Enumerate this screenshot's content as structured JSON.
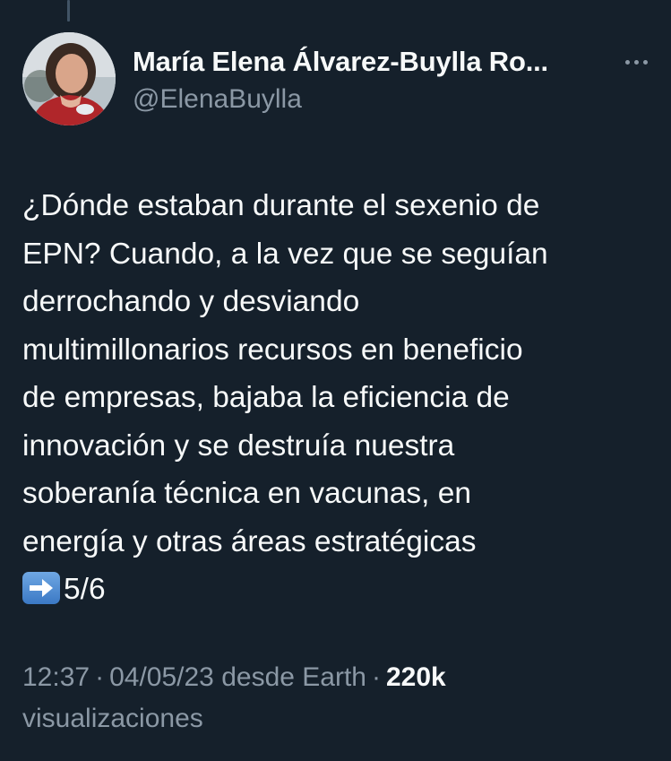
{
  "tweet": {
    "author": {
      "display_name": "María Elena Álvarez-Buylla Ro...",
      "handle": "@ElenaBuylla",
      "avatar_icon": "profile-photo"
    },
    "more_icon": "ellipsis-icon",
    "text_lines": [
      "¿Dónde estaban durante el sexenio de",
      "EPN? Cuando, a la vez que se seguían",
      "derrochando y desviando",
      "multimillonarios recursos en beneficio",
      "de empresas, bajaba la eficiencia de",
      "innovación y se destruía nuestra",
      "soberanía técnica en vacunas, en",
      "energía y otras áreas estratégicas"
    ],
    "thread_emoji": "right-arrow-emoji",
    "thread_counter": "5/6",
    "time": "12:37",
    "date": "04/05/23",
    "source": "desde Earth",
    "views_count": "220k",
    "views_label": "visualizaciones",
    "separator": "·"
  },
  "colors": {
    "background": "#15202b",
    "primary_text": "#f7f9f9",
    "secondary_text": "#8b98a5"
  }
}
